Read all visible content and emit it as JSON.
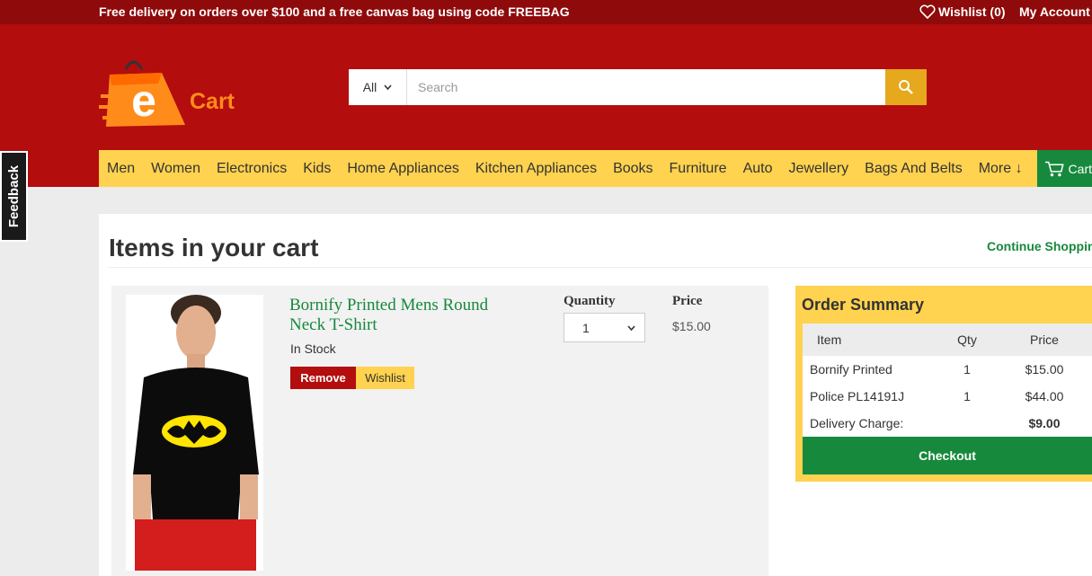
{
  "topbar": {
    "promo_text": "Free delivery on orders over $100 and a free canvas bag using code ",
    "promo_code": "FREEBAG",
    "wishlist_label": "Wishlist (0)",
    "account_label": "My Account"
  },
  "brand": {
    "logo_letter": "e",
    "name": "Cart"
  },
  "search": {
    "category_selected": "All",
    "placeholder": "Search"
  },
  "nav": {
    "items": [
      "Men",
      "Women",
      "Electronics",
      "Kids",
      "Home Appliances",
      "Kitchen Appliances",
      "Books",
      "Furniture",
      "Auto",
      "Jewellery",
      "Bags And Belts",
      "More ↓"
    ],
    "cart_label": "Cart"
  },
  "feedback_label": "Feedback",
  "cart": {
    "title": "Items in your cart",
    "continue_label": "Continue Shopping",
    "items": [
      {
        "name": "Bornify Printed Mens Round Neck T-Shirt",
        "stock": "In Stock",
        "remove_label": "Remove",
        "wishlist_label": "Wishlist",
        "quantity_label": "Quantity",
        "quantity": "1",
        "price_label": "Price",
        "price": "$15.00"
      }
    ]
  },
  "summary": {
    "title": "Order Summary",
    "headers": {
      "item": "Item",
      "qty": "Qty",
      "price": "Price"
    },
    "rows": [
      {
        "item": "Bornify Printed",
        "qty": "1",
        "price": "$15.00"
      },
      {
        "item": "Police PL14191J",
        "qty": "1",
        "price": "$44.00"
      }
    ],
    "delivery_label": "Delivery Charge:",
    "delivery_value": "$9.00",
    "checkout_label": "Checkout"
  },
  "colors": {
    "topbar": "#8f0a0a",
    "header": "#b30d0d",
    "nav": "#ffd24f",
    "green": "#16893c",
    "search_button": "#e6a81c"
  }
}
